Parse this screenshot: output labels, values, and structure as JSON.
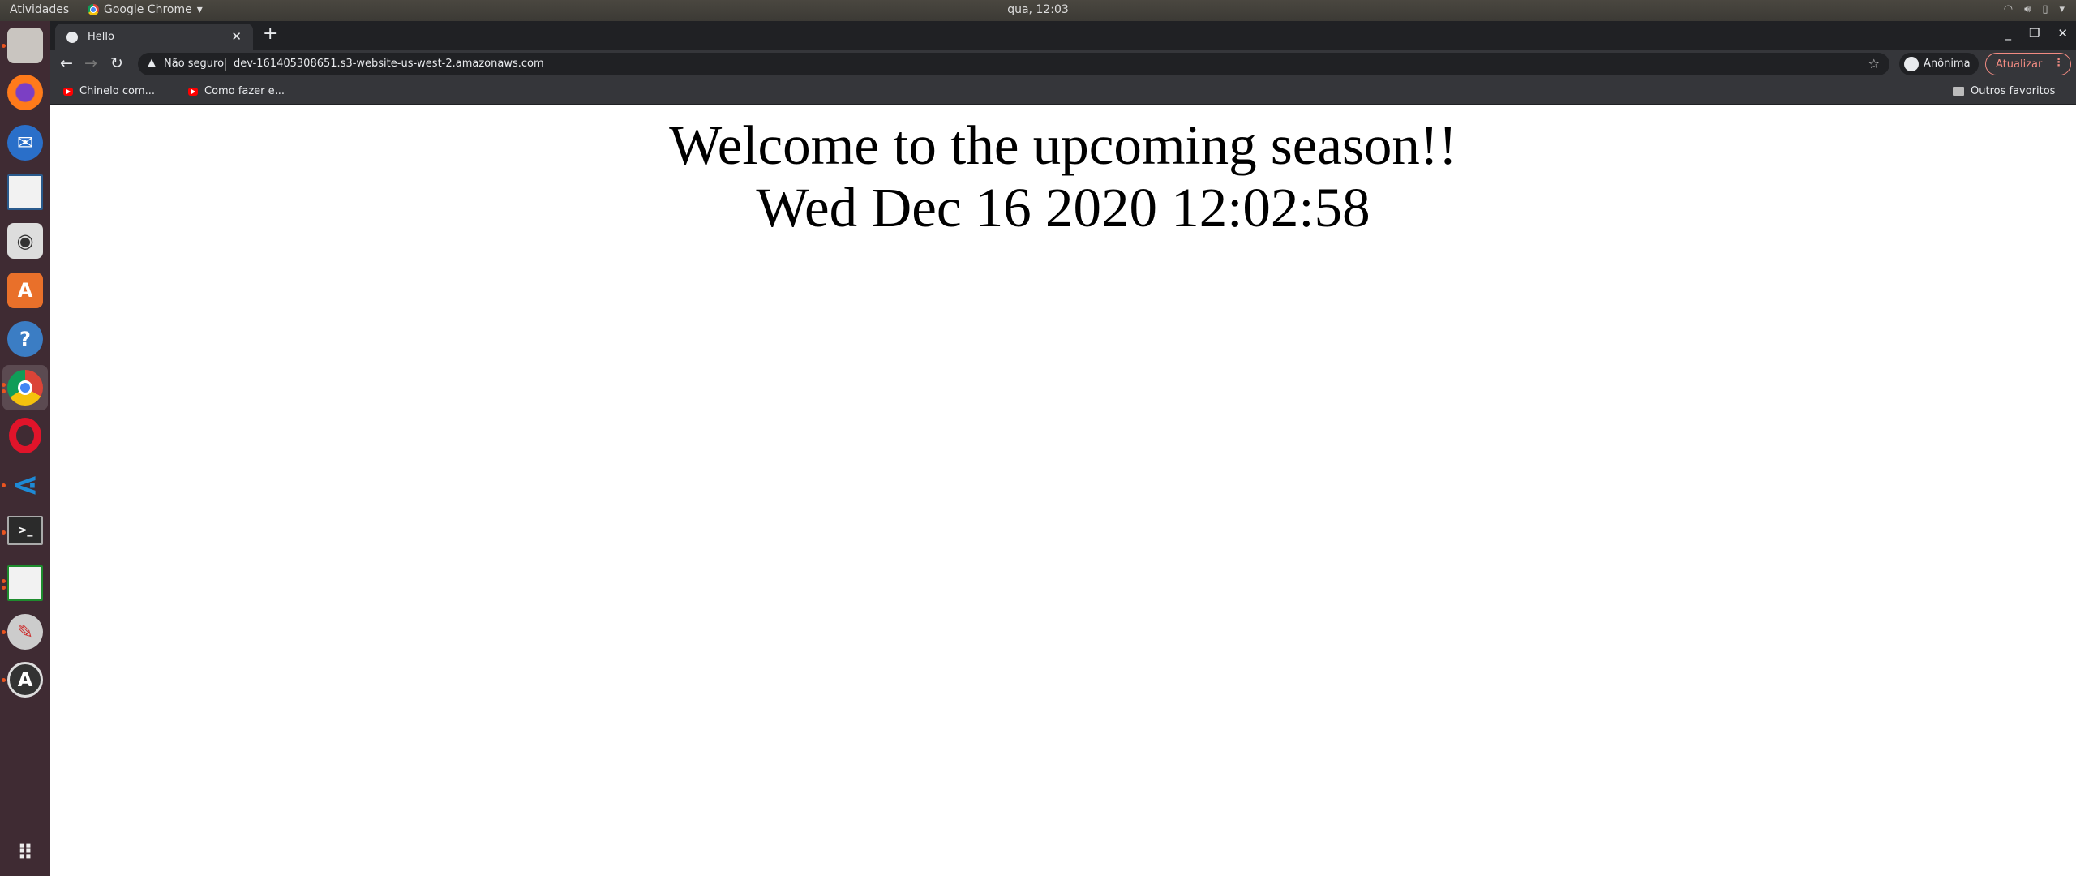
{
  "topbar": {
    "activities": "Atividades",
    "app_name": "Google Chrome",
    "clock": "qua, 12:03"
  },
  "browser": {
    "tab": {
      "title": "Hello"
    },
    "address": {
      "security": "Não seguro",
      "url": "dev-161405308651.s3-website-us-west-2.amazonaws.com"
    },
    "profile": "Anônima",
    "update": "Atualizar",
    "bookmarks": [
      {
        "label": "Chinelo com..."
      },
      {
        "label": "Como fazer e..."
      }
    ],
    "other_bookmarks": "Outros favoritos"
  },
  "page": {
    "heading": "Welcome to the upcoming season!!",
    "date": "Wed Dec 16 2020 12:02:58"
  },
  "dock": [
    "files",
    "firefox",
    "thunderbird",
    "libreoffice-impress",
    "rhythmbox",
    "ubuntu-software",
    "help",
    "chrome",
    "opera",
    "vscode",
    "terminal",
    "libreoffice-calc",
    "settings",
    "software-updater"
  ]
}
